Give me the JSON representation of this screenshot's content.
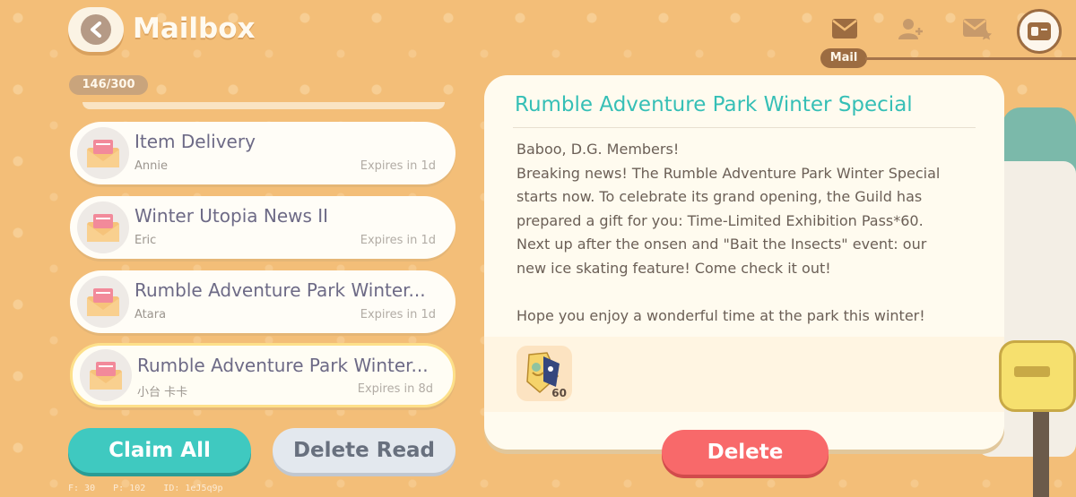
{
  "header": {
    "title": "Mailbox",
    "counter": "146/300",
    "active_tab_label": "Mail",
    "icons": [
      "mail-icon",
      "add-friend-icon",
      "star-mail-icon",
      "profile-card-icon"
    ]
  },
  "mails": [
    {
      "title": "Item Delivery",
      "sender": "Annie",
      "expiry": "Expires in 1d",
      "selected": false
    },
    {
      "title": "Winter Utopia News II",
      "sender": "Eric",
      "expiry": "Expires in 1d",
      "selected": false
    },
    {
      "title": "Rumble Adventure Park Winter...",
      "sender": "Atara",
      "expiry": "Expires in 1d",
      "selected": false
    },
    {
      "title": "Rumble Adventure Park Winter...",
      "sender": "小台 卡卡",
      "expiry": "Expires in 8d",
      "selected": true
    }
  ],
  "buttons": {
    "claim_all": "Claim All",
    "delete_read": "Delete Read",
    "delete": "Delete"
  },
  "detail": {
    "title": "Rumble Adventure Park Winter Special",
    "lines": [
      "Baboo, D.G. Members!",
      "Breaking news! The Rumble Adventure Park Winter Special",
      "starts now. To celebrate its grand opening, the Guild has",
      "prepared a gift for you: Time-Limited Exhibition Pass*60.",
      "Next up after the onsen and \"Bait the Insects\" event: our",
      "new ice skating feature! Come check it out!",
      "",
      "Hope you enjoy a wonderful time at the park this winter!"
    ],
    "attachment": {
      "icon": "exhibition-pass-icon",
      "quantity": "60"
    }
  },
  "debug": {
    "f": "F: 30",
    "p": "P: 102",
    "id": "ID: 1eJ5q9p"
  },
  "colors": {
    "accent_teal": "#3fc9c0",
    "delete_red": "#f8696a",
    "background": "#f3be78"
  }
}
